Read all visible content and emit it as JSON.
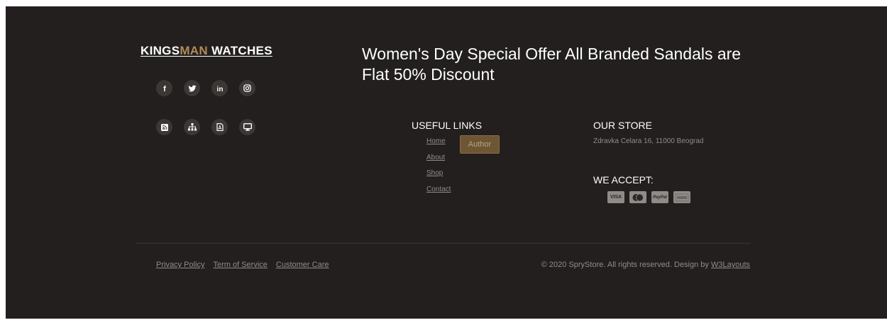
{
  "brand": {
    "logo_part1": "KINGS",
    "logo_part2": "MAN",
    "logo_part3": " WATCHES",
    "accent_color": "#b28a57"
  },
  "social_icons": [
    {
      "name": "facebook-icon",
      "glyph": "f"
    },
    {
      "name": "twitter-icon"
    },
    {
      "name": "linkedin-icon",
      "glyph": "in"
    },
    {
      "name": "instagram-icon"
    }
  ],
  "utility_icons": [
    {
      "name": "rss-icon"
    },
    {
      "name": "sitemap-icon"
    },
    {
      "name": "pdf-icon"
    },
    {
      "name": "desktop-icon"
    }
  ],
  "promo": {
    "headline": "Women's Day Special Offer All Branded Sandals are Flat 50% Discount"
  },
  "useful_links": {
    "title": "USEFUL LINKS",
    "items": [
      "Home",
      "About",
      "Shop",
      "Contact"
    ],
    "author_button": "Author"
  },
  "store": {
    "title": "OUR STORE",
    "address": "Zdravka Celara 16, 11000 Beograd",
    "accept_title": "WE ACCEPT:",
    "cards": [
      {
        "name": "visa-card-icon",
        "label": "VISA"
      },
      {
        "name": "mastercard-card-icon",
        "label": ""
      },
      {
        "name": "paypal-card-icon",
        "label": "PayPal"
      },
      {
        "name": "amex-card-icon",
        "label": ""
      }
    ]
  },
  "bottom": {
    "links": [
      "Privacy Policy",
      "Term of Service",
      "Customer Care"
    ],
    "copyright": "© 2020 SpryStore. All rights reserved. Design by ",
    "designer_link": "W3Layouts"
  },
  "colors": {
    "background": "#221f1e",
    "icon_circle": "#3a3735",
    "button": "#6e5634",
    "muted_text": "#8f8c89"
  }
}
